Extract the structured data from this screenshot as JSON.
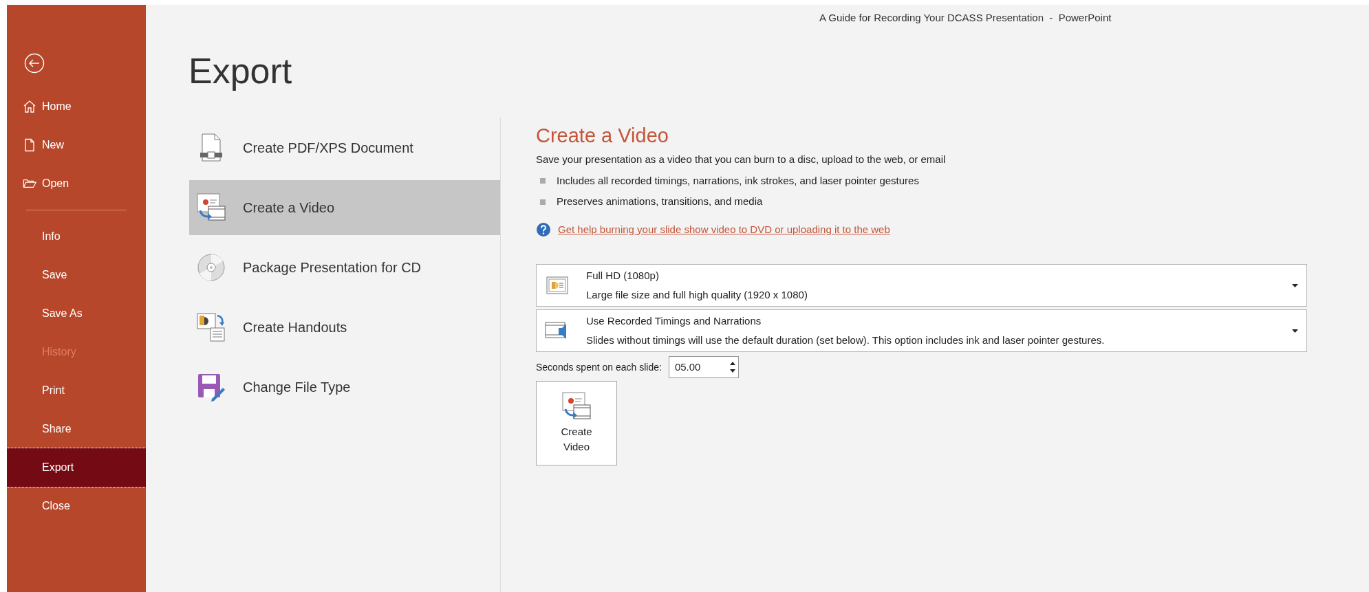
{
  "window": {
    "title": "A Guide for Recording Your DCASS Presentation  -  PowerPoint"
  },
  "sidebar": {
    "top_items": [
      {
        "label": "Home",
        "kind": "home",
        "selected": false,
        "disabled": false
      },
      {
        "label": "New",
        "kind": "new",
        "selected": false,
        "disabled": false
      },
      {
        "label": "Open",
        "kind": "open",
        "selected": false,
        "disabled": false
      }
    ],
    "items": [
      {
        "label": "Info",
        "selected": false,
        "disabled": false
      },
      {
        "label": "Save",
        "selected": false,
        "disabled": false
      },
      {
        "label": "Save As",
        "selected": false,
        "disabled": false
      },
      {
        "label": "History",
        "selected": false,
        "disabled": true
      },
      {
        "label": "Print",
        "selected": false,
        "disabled": false
      },
      {
        "label": "Share",
        "selected": false,
        "disabled": false
      },
      {
        "label": "Export",
        "selected": true,
        "disabled": false
      },
      {
        "label": "Close",
        "selected": false,
        "disabled": false
      }
    ]
  },
  "page_title": "Export",
  "export_options": [
    {
      "label": "Create PDF/XPS Document",
      "kind": "pdf",
      "selected": false
    },
    {
      "label": "Create a Video",
      "kind": "video",
      "selected": true
    },
    {
      "label": "Package Presentation for CD",
      "kind": "cd",
      "selected": false
    },
    {
      "label": "Create Handouts",
      "kind": "handouts",
      "selected": false
    },
    {
      "label": "Change File Type",
      "kind": "filetype",
      "selected": false
    }
  ],
  "detail": {
    "title": "Create a Video",
    "description": "Save your presentation as a video that you can burn to a disc, upload to the web, or email",
    "bullets": [
      "Includes all recorded timings, narrations, ink strokes, and laser pointer gestures",
      "Preserves animations, transitions, and media"
    ],
    "help_link": "Get help burning your slide show video to DVD or uploading it to the web",
    "dropdowns": [
      {
        "kind": "quality",
        "title": "Full HD (1080p)",
        "subtitle": "Large file size and full high quality (1920 x 1080)"
      },
      {
        "kind": "timings",
        "title": "Use Recorded Timings and Narrations",
        "subtitle": "Slides without timings will use the default duration (set below). This option includes ink and laser pointer gestures."
      }
    ],
    "seconds_label": "Seconds spent on each slide:",
    "seconds_value": "05.00",
    "create_button": "Create Video"
  }
}
